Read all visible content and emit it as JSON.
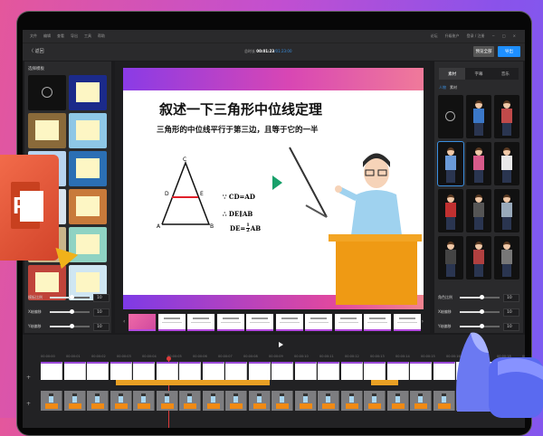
{
  "menu": {
    "items": [
      "文件",
      "编辑",
      "查看",
      "导出",
      "工具",
      "帮助"
    ],
    "right": [
      "论坛",
      "升级账户",
      "登录 / 注册"
    ],
    "window_controls": [
      "−",
      "□",
      "×"
    ]
  },
  "toolbar": {
    "back": "〈 返回",
    "duration_label": "总时长",
    "duration_current": "00:01:23",
    "duration_total": "/01:23:00",
    "preview_all": "预览全部",
    "export": "导出"
  },
  "left_panel": {
    "title": "选择模板",
    "sliders": [
      {
        "label": "模板比例",
        "value": "10",
        "fraction": 0.55
      },
      {
        "label": "X轴偏移",
        "value": "10",
        "fraction": 0.55
      },
      {
        "label": "Y轴偏移",
        "value": "10",
        "fraction": 0.55
      }
    ]
  },
  "slide": {
    "title": "叙述一下三角形中位线定理",
    "subtitle": "三角形的中位线平行于第三边，且等于它的一半",
    "vertices": {
      "a": "A",
      "b": "B",
      "c": "C",
      "d": "D",
      "e": "E"
    },
    "proof": {
      "l1": "∵ CD=AD",
      "l2": "∴ DE∥AB",
      "l3a": "DE=",
      "num": "1",
      "den": "2",
      "l3b": "AB"
    }
  },
  "right_panel": {
    "tabs": [
      "素材",
      "字幕",
      "音乐"
    ],
    "category_person": "人物",
    "category_material": "素材",
    "sliders": [
      {
        "label": "角色比例",
        "value": "10",
        "fraction": 0.55
      },
      {
        "label": "X轴偏移",
        "value": "10",
        "fraction": 0.55
      },
      {
        "label": "Y轴偏移",
        "value": "10",
        "fraction": 0.55
      }
    ]
  },
  "timeline": {
    "ticks": [
      "00:00:00",
      "00:00:01",
      "00:00:02",
      "00:00:03",
      "00:00:04",
      "00:00:05",
      "00:00:06",
      "00:00:07",
      "00:00:08",
      "00:00:09",
      "00:00:10",
      "00:00:11",
      "00:00:12",
      "00:00:13",
      "00:00:14",
      "00:00:15",
      "00:00:16",
      "00:00:17",
      "00:00:18",
      "00:00:19"
    ],
    "track_add": "+"
  },
  "colors": {
    "accent": "#1e8fff",
    "orange": "#f0a020",
    "ppt": "#d24726"
  }
}
